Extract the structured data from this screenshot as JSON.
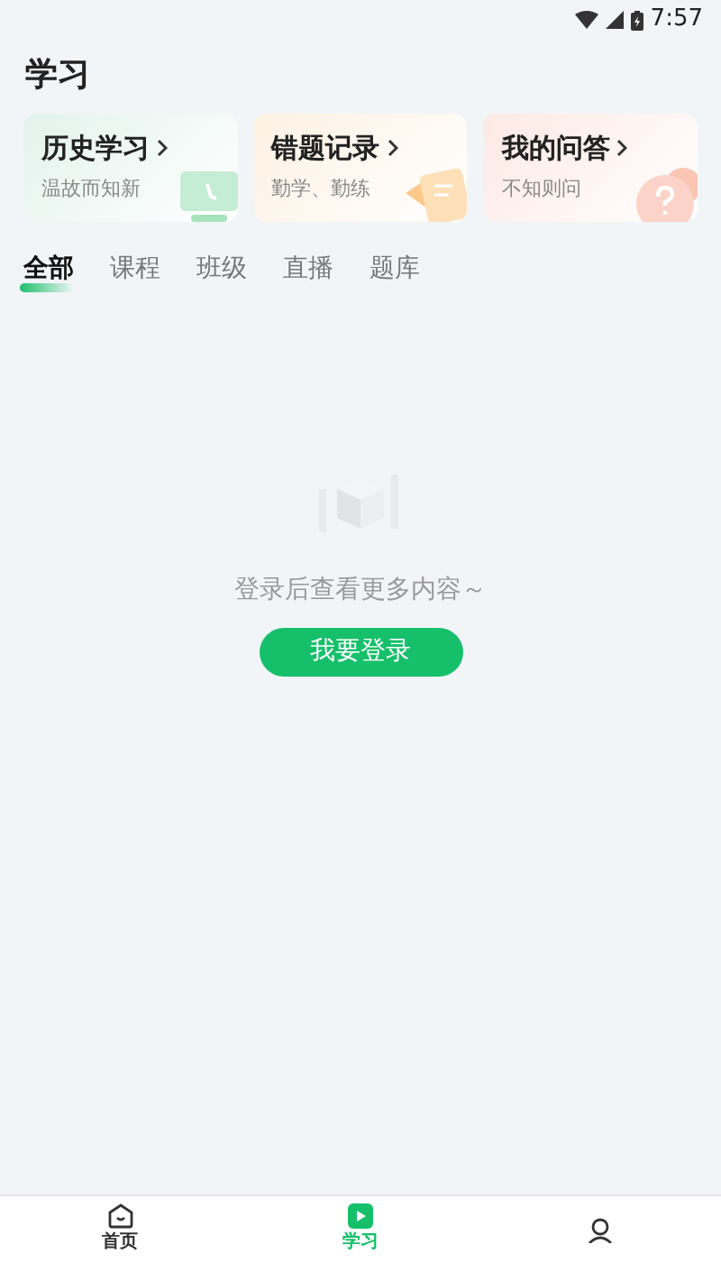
{
  "status_bar": {
    "time": "7:57"
  },
  "page_title": "学习",
  "shortcuts": [
    {
      "title": "历史学习",
      "subtitle": "温故而知新",
      "kind": "monitor",
      "color": "#e3f3ec"
    },
    {
      "title": "错题记录",
      "subtitle": "勤学、勤练",
      "kind": "papers",
      "color": "#fdf1e2"
    },
    {
      "title": "我的问答",
      "subtitle": "不知则问",
      "kind": "question",
      "color": "#fde9e4"
    }
  ],
  "tabs": [
    {
      "label": "全部",
      "selected": true
    },
    {
      "label": "课程",
      "selected": false
    },
    {
      "label": "班级",
      "selected": false
    },
    {
      "label": "直播",
      "selected": false
    },
    {
      "label": "题库",
      "selected": false
    }
  ],
  "empty_state": {
    "message": "登录后查看更多内容～",
    "button": "我要登录"
  },
  "bottom_nav": [
    {
      "label": "首页",
      "kind": "home",
      "selected": false
    },
    {
      "label": "学习",
      "kind": "study",
      "selected": true
    },
    {
      "kind": "profile",
      "selected": false
    }
  ]
}
